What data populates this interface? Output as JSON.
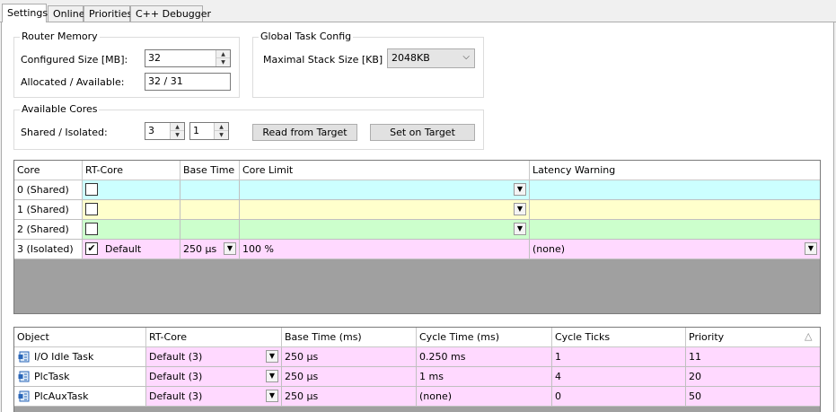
{
  "tabs": [
    {
      "label": "Settings"
    },
    {
      "label": "Online"
    },
    {
      "label": "Priorities"
    },
    {
      "label": "C++ Debugger"
    }
  ],
  "router_memory": {
    "title": "Router Memory",
    "configured_label": "Configured Size [MB]:",
    "configured_value": "32",
    "allocated_label": "Allocated / Available:",
    "allocated_value": "32 / 31"
  },
  "global_task_config": {
    "title": "Global Task Config",
    "stack_label": "Maximal Stack Size [KB]",
    "stack_value": "2048KB"
  },
  "available_cores": {
    "title": "Available Cores",
    "label": "Shared / Isolated:",
    "shared": "3",
    "isolated": "1",
    "read_button": "Read from Target",
    "set_button": "Set on Target"
  },
  "core_table": {
    "headers": [
      "Core",
      "RT-Core",
      "Base Time",
      "Core Limit",
      "Latency Warning"
    ],
    "rows": [
      {
        "core": "0 (Shared)",
        "rt": "",
        "checked": false,
        "base": "",
        "limit": "",
        "latency": ""
      },
      {
        "core": "1 (Shared)",
        "rt": "",
        "checked": false,
        "base": "",
        "limit": "",
        "latency": ""
      },
      {
        "core": "2 (Shared)",
        "rt": "",
        "checked": false,
        "base": "",
        "limit": "",
        "latency": ""
      },
      {
        "core": "3 (Isolated)",
        "rt": "Default",
        "checked": true,
        "base": "250 µs",
        "limit": "100 %",
        "latency": "(none)"
      }
    ],
    "colors": {
      "cyan": "#ccffff",
      "yellow": "#ffffcc",
      "green": "#ccffcc",
      "pink": "#ffd9ff"
    }
  },
  "task_table": {
    "headers": [
      "Object",
      "RT-Core",
      "Base Time (ms)",
      "Cycle Time (ms)",
      "Cycle Ticks",
      "Priority"
    ],
    "rows": [
      {
        "object": "I/O Idle Task",
        "rt": "Default (3)",
        "base": "250 µs",
        "cycle": "0.250 ms",
        "ticks": "1",
        "priority": "11"
      },
      {
        "object": "PlcTask",
        "rt": "Default (3)",
        "base": "250 µs",
        "cycle": "1 ms",
        "ticks": "4",
        "priority": "20"
      },
      {
        "object": "PlcAuxTask",
        "rt": "Default (3)",
        "base": "250 µs",
        "cycle": "(none)",
        "ticks": "0",
        "priority": "50"
      }
    ]
  },
  "icons": {
    "task": "task-icon",
    "check": "✔",
    "dropdown": "▼",
    "sort": "△"
  }
}
